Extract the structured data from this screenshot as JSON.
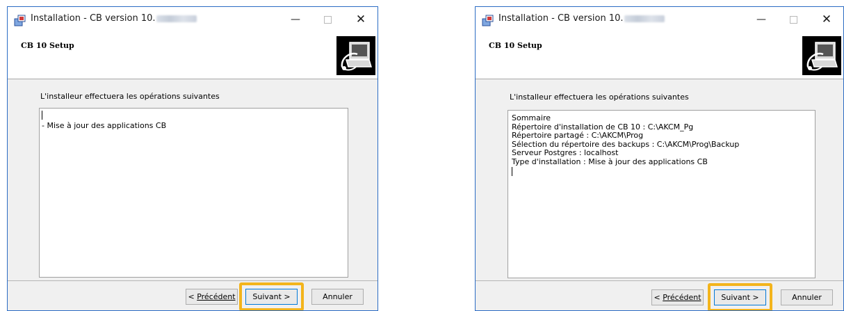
{
  "left": {
    "window_title": "Installation - CB version 10.",
    "header_title": "CB 10 Setup",
    "description": "L'installeur effectuera les opérations suivantes",
    "lines": [
      "-  Mise à jour des applications CB"
    ],
    "buttons": {
      "back": "Précédent",
      "next": "Suivant >",
      "cancel": "Annuler"
    }
  },
  "right": {
    "window_title": "Installation - CB version 10.",
    "header_title": "CB 10 Setup",
    "description": "L'installeur effectuera les opérations suivantes",
    "lines": [
      "Sommaire",
      "Répertoire d'installation de CB 10 : C:\\AKCM_Pg",
      "Répertoire partagé : C:\\AKCM\\Prog",
      "Sélection du répertoire des backups : C:\\AKCM\\Prog\\Backup",
      "Serveur Postgres : localhost",
      "Type d'installation :  Mise à jour des applications CB"
    ],
    "buttons": {
      "back": "Précédent",
      "next": "Suivant >",
      "cancel": "Annuler"
    }
  },
  "icons": {
    "app": "installer-icon",
    "minimize": "minimize-icon",
    "maximize": "maximize-icon",
    "close": "close-icon",
    "logo": "computer-install-logo"
  },
  "colors": {
    "window_border": "#2b6cc4",
    "highlight": "#f3b41c",
    "default_button_border": "#0078d7"
  }
}
